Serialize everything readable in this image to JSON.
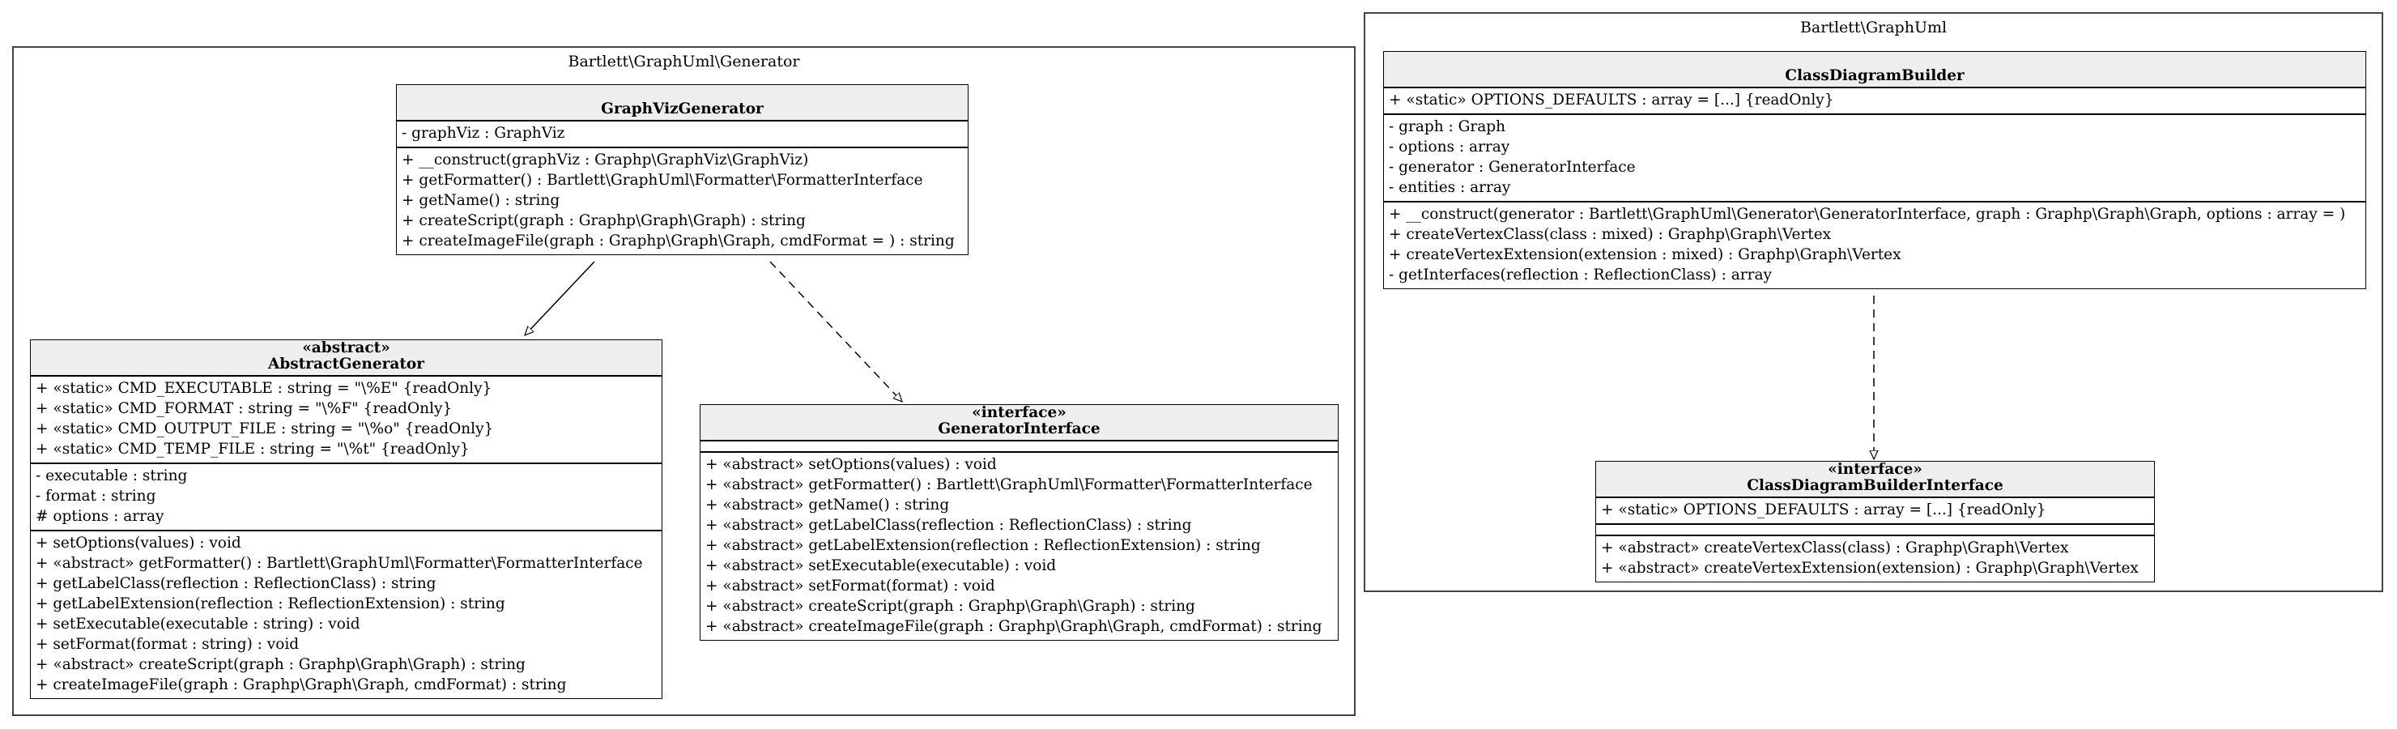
{
  "packages": {
    "generator": {
      "label": "Bartlett\\GraphUml\\Generator"
    },
    "graphuml": {
      "label": "Bartlett\\GraphUml"
    }
  },
  "classes": {
    "gvg": {
      "stereotype": "",
      "name": "GraphVizGenerator",
      "compartments": [
        [
          "- graphViz : GraphViz"
        ],
        [
          "+ __construct(graphViz : Graphp\\GraphViz\\GraphViz)",
          "+ getFormatter() : Bartlett\\GraphUml\\Formatter\\FormatterInterface",
          "+ getName() : string",
          "+ createScript(graph : Graphp\\Graph\\Graph) : string",
          "+ createImageFile(graph : Graphp\\Graph\\Graph, cmdFormat = ) : string"
        ]
      ]
    },
    "ag": {
      "stereotype": "«abstract»",
      "name": "AbstractGenerator",
      "compartments": [
        [
          "+ «static» CMD_EXECUTABLE : string = \"\\%E\" {readOnly}",
          "+ «static» CMD_FORMAT : string = \"\\%F\" {readOnly}",
          "+ «static» CMD_OUTPUT_FILE : string = \"\\%o\" {readOnly}",
          "+ «static» CMD_TEMP_FILE : string = \"\\%t\" {readOnly}"
        ],
        [
          "- executable : string",
          "- format : string",
          "# options : array"
        ],
        [
          "+ setOptions(values) : void",
          "+ «abstract» getFormatter() : Bartlett\\GraphUml\\Formatter\\FormatterInterface",
          "+ getLabelClass(reflection : ReflectionClass) : string",
          "+ getLabelExtension(reflection : ReflectionExtension) : string",
          "+ setExecutable(executable : string) : void",
          "+ setFormat(format : string) : void",
          "+ «abstract» createScript(graph : Graphp\\Graph\\Graph) : string",
          "+ createImageFile(graph : Graphp\\Graph\\Graph, cmdFormat) : string"
        ]
      ]
    },
    "gi": {
      "stereotype": "«interface»",
      "name": "GeneratorInterface",
      "compartments": [
        [],
        [
          "+ «abstract» setOptions(values) : void",
          "+ «abstract» getFormatter() : Bartlett\\GraphUml\\Formatter\\FormatterInterface",
          "+ «abstract» getName() : string",
          "+ «abstract» getLabelClass(reflection : ReflectionClass) : string",
          "+ «abstract» getLabelExtension(reflection : ReflectionExtension) : string",
          "+ «abstract» setExecutable(executable) : void",
          "+ «abstract» setFormat(format) : void",
          "+ «abstract» createScript(graph : Graphp\\Graph\\Graph) : string",
          "+ «abstract» createImageFile(graph : Graphp\\Graph\\Graph, cmdFormat) : string"
        ]
      ]
    },
    "cdb": {
      "stereotype": "",
      "name": "ClassDiagramBuilder",
      "compartments": [
        [
          "+ «static» OPTIONS_DEFAULTS : array = [...] {readOnly}"
        ],
        [
          "- graph : Graph",
          "- options : array",
          "- generator : GeneratorInterface",
          "- entities : array"
        ],
        [
          "+ __construct(generator : Bartlett\\GraphUml\\Generator\\GeneratorInterface, graph : Graphp\\Graph\\Graph, options : array = )",
          "+ createVertexClass(class : mixed) : Graphp\\Graph\\Vertex",
          "+ createVertexExtension(extension : mixed) : Graphp\\Graph\\Vertex",
          "- getInterfaces(reflection : ReflectionClass) : array"
        ]
      ]
    },
    "cdbi": {
      "stereotype": "«interface»",
      "name": "ClassDiagramBuilderInterface",
      "compartments": [
        [
          "+ «static» OPTIONS_DEFAULTS : array = [...] {readOnly}"
        ],
        [],
        [
          "+ «abstract» createVertexClass(class) : Graphp\\Graph\\Vertex",
          "+ «abstract» createVertexExtension(extension) : Graphp\\Graph\\Vertex"
        ]
      ]
    }
  },
  "relations": [
    {
      "from": "GraphVizGenerator",
      "to": "AbstractGenerator",
      "kind": "generalization"
    },
    {
      "from": "GraphVizGenerator",
      "to": "GeneratorInterface",
      "kind": "realization"
    },
    {
      "from": "ClassDiagramBuilder",
      "to": "ClassDiagramBuilderInterface",
      "kind": "realization"
    }
  ]
}
